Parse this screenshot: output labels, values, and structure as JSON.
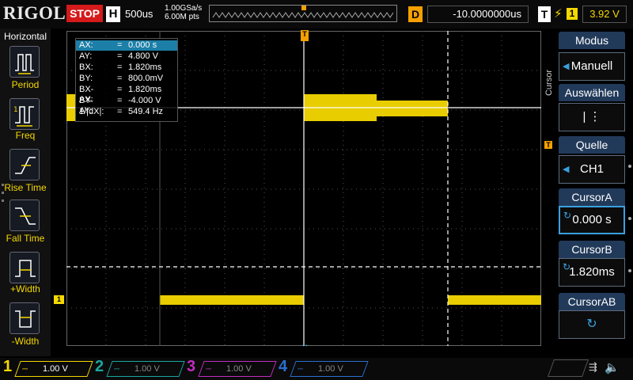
{
  "topbar": {
    "brand": "RIGOL",
    "run_state": "STOP",
    "horizontal_badge": "H",
    "timebase": "500us",
    "sample_rate": "1.00GSa/s",
    "memory_depth": "6.00M pts",
    "delay_badge": "D",
    "delay_value": "-10.0000000us",
    "trigger_badge": "T",
    "trigger_source": "1",
    "trigger_level": "3.92 V"
  },
  "left_panel": {
    "title": "Horizontal",
    "items": [
      {
        "label": "Period"
      },
      {
        "label": "Freq"
      },
      {
        "label": "Rise Time"
      },
      {
        "label": "Fall Time"
      },
      {
        "label": "+Width"
      },
      {
        "label": "-Width"
      }
    ]
  },
  "cursor_readout": {
    "rows": [
      {
        "key": "AX:",
        "eq": "=",
        "value": "0.000 s"
      },
      {
        "key": "AY:",
        "eq": "=",
        "value": "4.800 V"
      },
      {
        "key": "BX:",
        "eq": "=",
        "value": "1.820ms"
      },
      {
        "key": "BY:",
        "eq": "=",
        "value": "800.0mV"
      },
      {
        "key": "BX-AX:",
        "eq": "=",
        "value": "1.820ms"
      },
      {
        "key": "BY-AY:",
        "eq": "=",
        "value": "-4.000 V"
      },
      {
        "key": "1/|dX|:",
        "eq": "=",
        "value": "549.4 Hz"
      }
    ]
  },
  "markers": {
    "trigger_position": "T",
    "trigger_level": "T",
    "channel1": "1"
  },
  "right_panel": {
    "side_label": "Cursor",
    "sections": [
      {
        "header": "Modus",
        "value": "Manuell"
      },
      {
        "header": "Auswählen",
        "value": "|  ⋮"
      },
      {
        "header": "Quelle",
        "value": "CH1"
      },
      {
        "header": "CursorA",
        "value": "0.000 s"
      },
      {
        "header": "CursorB",
        "value": "1.820ms"
      },
      {
        "header": "CursorAB",
        "value": ""
      }
    ]
  },
  "channels": [
    {
      "num": "1",
      "coupling": "⎓",
      "scale": "1.00 V",
      "color": "#f5d800"
    },
    {
      "num": "2",
      "coupling": "⎓",
      "scale": "1.00 V",
      "color": "#1aa7a0"
    },
    {
      "num": "3",
      "coupling": "⎓",
      "scale": "1.00 V",
      "color": "#c02ec0"
    },
    {
      "num": "4",
      "coupling": "⎓",
      "scale": "1.00 V",
      "color": "#2a70d0"
    }
  ],
  "colors": {
    "ch1": "#f5d800",
    "accent_blue": "#3aa0e0",
    "stop_red": "#d41a1a",
    "trigger_orange": "#f5a000"
  }
}
